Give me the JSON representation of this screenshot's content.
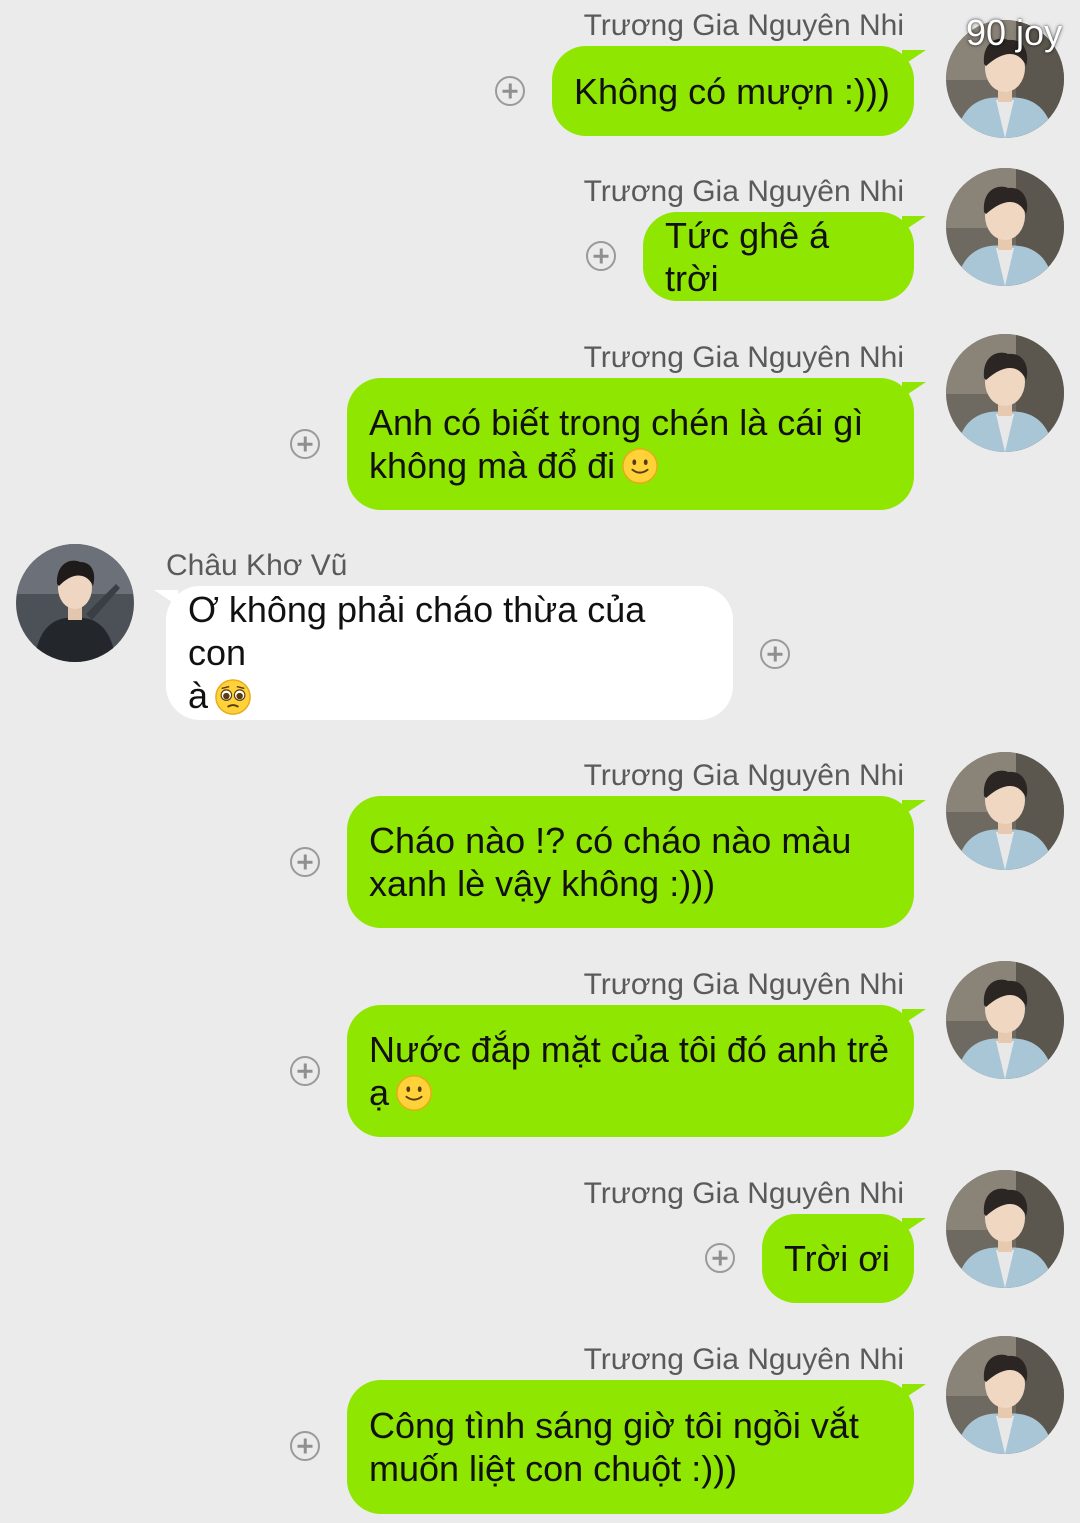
{
  "watermark": "90 joy",
  "participants": {
    "self": "Trương Gia Nguyên Nhi",
    "other": "Châu Khơ Vũ"
  },
  "icons": {
    "add": "plus-circle-icon",
    "emoji_smile": "slightly-smiling-face-emoji",
    "emoji_pleading": "pleading-face-emoji"
  },
  "colors": {
    "outgoing_bubble": "#8fe600",
    "incoming_bubble": "#ffffff",
    "background": "#ebebeb"
  },
  "messages": [
    {
      "sender": "Trương Gia Nguyên Nhi",
      "text": "Không có mượn :)))"
    },
    {
      "sender": "Trương Gia Nguyên Nhi",
      "text": "Tức ghê á trời"
    },
    {
      "sender": "Trương Gia Nguyên Nhi",
      "text": "Anh có biết trong chén là cái gì\nkhông mà đổ đi",
      "emoji": "slightly-smiling-face"
    },
    {
      "sender": "Châu Khơ Vũ",
      "text": "Ơ không phải cháo thừa của con\nà",
      "emoji": "pleading-face"
    },
    {
      "sender": "Trương Gia Nguyên Nhi",
      "text": "Cháo nào !? có cháo nào màu\nxanh lè vậy không :)))"
    },
    {
      "sender": "Trương Gia Nguyên Nhi",
      "text": "Nước đắp mặt của tôi đó anh trẻ\nạ",
      "emoji": "slightly-smiling-face"
    },
    {
      "sender": "Trương Gia Nguyên Nhi",
      "text": "Trời ơi"
    },
    {
      "sender": "Trương Gia Nguyên Nhi",
      "text": "Công tình sáng giờ tôi ngồi vắt\nmuốn liệt con chuột :)))"
    }
  ]
}
